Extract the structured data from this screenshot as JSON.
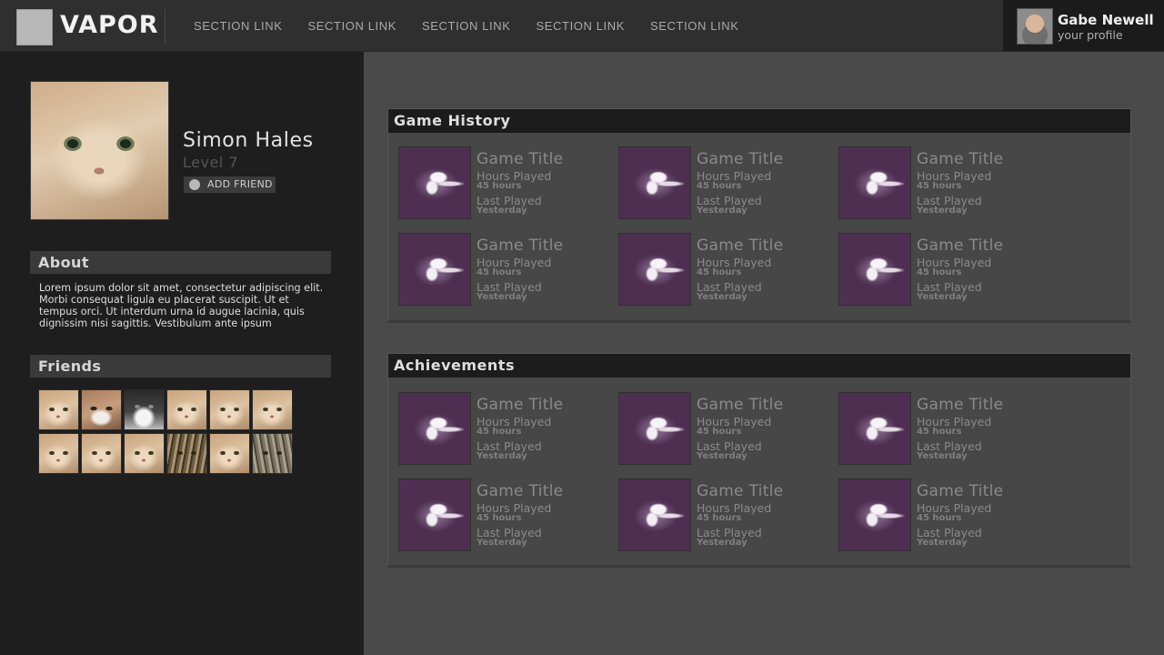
{
  "header": {
    "logo_text": "VAPOR",
    "nav": [
      "SECTION LINK",
      "SECTION LINK",
      "SECTION LINK",
      "SECTION LINK",
      "SECTION LINK"
    ],
    "user": {
      "name": "Gabe Newell",
      "subtitle": "your profile"
    }
  },
  "profile": {
    "name": "Simon Hales",
    "level": "Level 7",
    "add_friend_label": "ADD FRIEND"
  },
  "about": {
    "heading": "About",
    "text": "Lorem ipsum dolor sit amet, consectetur adipiscing elit. Morbi consequat ligula eu placerat suscipit. Ut et tempus orci. Ut interdum urna id augue lacinia, quis dignissim nisi sagittis. Vestibulum ante ipsum"
  },
  "friends": {
    "heading": "Friends",
    "avatars": [
      "cat-icon",
      "grumpy-cat-icon",
      "black-white-cat-icon",
      "cat-icon",
      "cat-icon",
      "cat-icon",
      "cat-icon",
      "cat-icon",
      "cat-icon",
      "tabby-cat-icon",
      "cat-icon",
      "tabby-cat-icon"
    ]
  },
  "game_history": {
    "heading": "Game History",
    "items": [
      {
        "title": "Game Title",
        "hours_label": "Hours Played",
        "hours": "45 hours",
        "last_label": "Last Played",
        "last": "Yesterday"
      },
      {
        "title": "Game Title",
        "hours_label": "Hours Played",
        "hours": "45 hours",
        "last_label": "Last Played",
        "last": "Yesterday"
      },
      {
        "title": "Game Title",
        "hours_label": "Hours Played",
        "hours": "45 hours",
        "last_label": "Last Played",
        "last": "Yesterday"
      },
      {
        "title": "Game Title",
        "hours_label": "Hours Played",
        "hours": "45 hours",
        "last_label": "Last Played",
        "last": "Yesterday"
      },
      {
        "title": "Game Title",
        "hours_label": "Hours Played",
        "hours": "45 hours",
        "last_label": "Last Played",
        "last": "Yesterday"
      },
      {
        "title": "Game Title",
        "hours_label": "Hours Played",
        "hours": "45 hours",
        "last_label": "Last Played",
        "last": "Yesterday"
      }
    ]
  },
  "achievements": {
    "heading": "Achievements",
    "items": [
      {
        "title": "Game Title",
        "hours_label": "Hours Played",
        "hours": "45 hours",
        "last_label": "Last Played",
        "last": "Yesterday"
      },
      {
        "title": "Game Title",
        "hours_label": "Hours Played",
        "hours": "45 hours",
        "last_label": "Last Played",
        "last": "Yesterday"
      },
      {
        "title": "Game Title",
        "hours_label": "Hours Played",
        "hours": "45 hours",
        "last_label": "Last Played",
        "last": "Yesterday"
      },
      {
        "title": "Game Title",
        "hours_label": "Hours Played",
        "hours": "45 hours",
        "last_label": "Last Played",
        "last": "Yesterday"
      },
      {
        "title": "Game Title",
        "hours_label": "Hours Played",
        "hours": "45 hours",
        "last_label": "Last Played",
        "last": "Yesterday"
      },
      {
        "title": "Game Title",
        "hours_label": "Hours Played",
        "hours": "45 hours",
        "last_label": "Last Played",
        "last": "Yesterday"
      }
    ]
  },
  "colors": {
    "topbar": "#2f2f2f",
    "sidebar": "#1e1e1e",
    "main_bg": "#4a4a4a",
    "panel_header": "#1c1c1c",
    "game_art": "#4e2f52"
  }
}
